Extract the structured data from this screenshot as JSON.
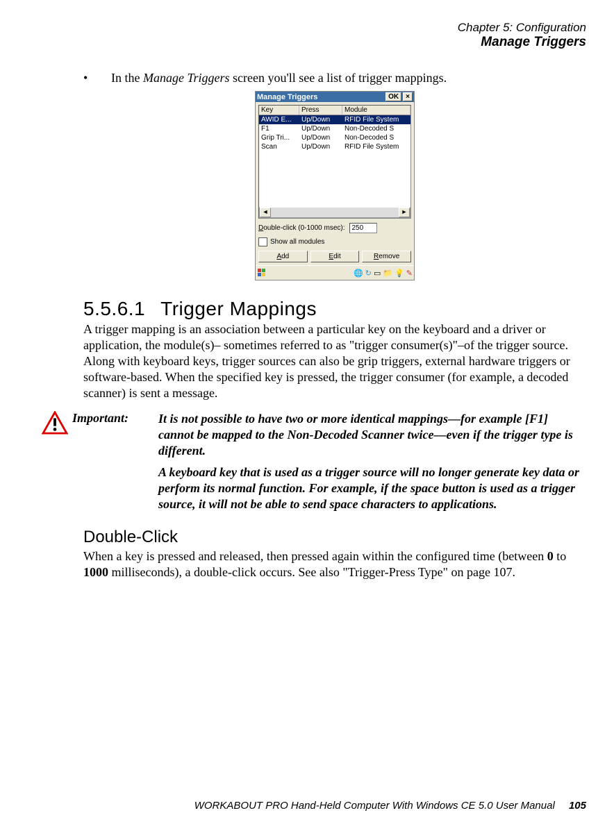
{
  "header": {
    "chapter": "Chapter 5: Configuration",
    "section": "Manage Triggers"
  },
  "bullet": {
    "prefix": "In the ",
    "emph": "Manage Triggers",
    "suffix": " screen you'll see a list of trigger mappings."
  },
  "window": {
    "title": "Manage Triggers",
    "ok_label": "OK",
    "close_label": "×",
    "columns": {
      "key": "Key",
      "press": "Press",
      "module": "Module"
    },
    "rows": [
      {
        "key": "AWID E...",
        "press": "Up/Down",
        "module": "RFID File System",
        "selected": true
      },
      {
        "key": "F1",
        "press": "Up/Down",
        "module": "Non-Decoded S"
      },
      {
        "key": "Grip Tri...",
        "press": "Up/Down",
        "module": "Non-Decoded S"
      },
      {
        "key": "Scan",
        "press": "Up/Down",
        "module": "RFID File System"
      }
    ],
    "dblclick": {
      "label_pre": "D",
      "label_rest": "ouble-click (0-1000 msec):",
      "value": "250"
    },
    "showall": {
      "label_pre": "S",
      "label_rest": "how all modules"
    },
    "buttons": {
      "add": {
        "u": "A",
        "rest": "dd"
      },
      "edit": {
        "u": "E",
        "rest": "dit"
      },
      "remove": {
        "u": "R",
        "rest": "emove"
      }
    }
  },
  "section_h": {
    "number": "5.5.6.1",
    "title": "Trigger Mappings"
  },
  "para_main": "A trigger mapping is an association between a particular key on the keyboard and a driver or application, the module(s)– sometimes referred to as \"trigger consumer(s)\"–of the trigger source. Along with keyboard keys, trigger sources can also be grip triggers, external hardware triggers or software-based. When the specified key is pressed, the trigger consumer (for example, a decoded scanner) is sent a message.",
  "important": {
    "label": "Important:",
    "p1": "It is not possible to have two or more identical mappings—for example [F1] cannot be mapped to the Non-Decoded Scanner twice—even if the trigger type is different.",
    "p2": "A keyboard key that is used as a trigger source will no longer generate key data or perform its normal function. For example, if the space button is used as a trigger source, it will not be able to send space characters to applications."
  },
  "sub_h": "Double-Click",
  "para_dbl": {
    "t1": "When a key is pressed and released, then pressed again within the configured time (between ",
    "b1": "0",
    "t2": " to ",
    "b2": "1000",
    "t3": " milliseconds), a double-click occurs. See also \"Trigger-Press Type\" on page 107."
  },
  "footer": {
    "text": "WORKABOUT PRO Hand-Held Computer With Windows CE 5.0 User Manual",
    "page": "105"
  }
}
